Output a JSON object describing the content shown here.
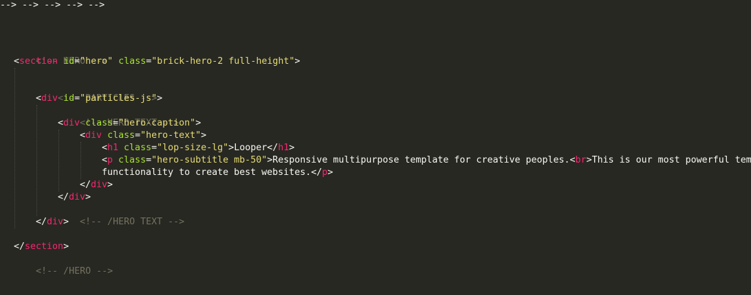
{
  "editor": {
    "theme_colors": {
      "background": "#272822",
      "comment": "#75715e",
      "tag": "#f92672",
      "attribute": "#a6e22e",
      "string": "#e6db74",
      "text": "#f8f8f2"
    },
    "lines": [
      {
        "comment": "<!-- HERO -->"
      },
      {
        "tag": "section",
        "attr1": "id",
        "val1": "\"hero\"",
        "attr2": "class",
        "val2": "\"brick-hero-2 full-height\""
      },
      {
        "comment": "<!-- PARTICLES -->"
      },
      {
        "tag": "div",
        "attr1": "id",
        "val1": "\"particles-js\""
      },
      {
        "comment": "<!-- HERO TEXT -->"
      },
      {
        "tag": "div",
        "attr1": "class",
        "val1": "\"hero-caption\""
      },
      {
        "tag": "div",
        "attr1": "class",
        "val1": "\"hero-text\""
      },
      {
        "tag": "h1",
        "attr1": "class",
        "val1": "\"lop-size-lg\"",
        "text": "Looper",
        "close_tag": "h1"
      },
      {
        "tag": "p",
        "attr1": "class",
        "val1": "\"hero-subtitle mb-50\"",
        "text1": "Responsive multipurpose template for creative peoples.",
        "br_tag": "br",
        "text2": "This is our most powerful tem"
      },
      {
        "text": "functionality to create best websites.",
        "close_tag": "p"
      },
      {
        "close_tag": "div"
      },
      {
        "close_tag": "div"
      },
      {
        "comment": "<!-- /HERO TEXT -->"
      },
      {
        "close_tag": "div"
      },
      {
        "close_tag": "section"
      },
      {
        "comment": "<!-- /HERO -->"
      }
    ]
  }
}
